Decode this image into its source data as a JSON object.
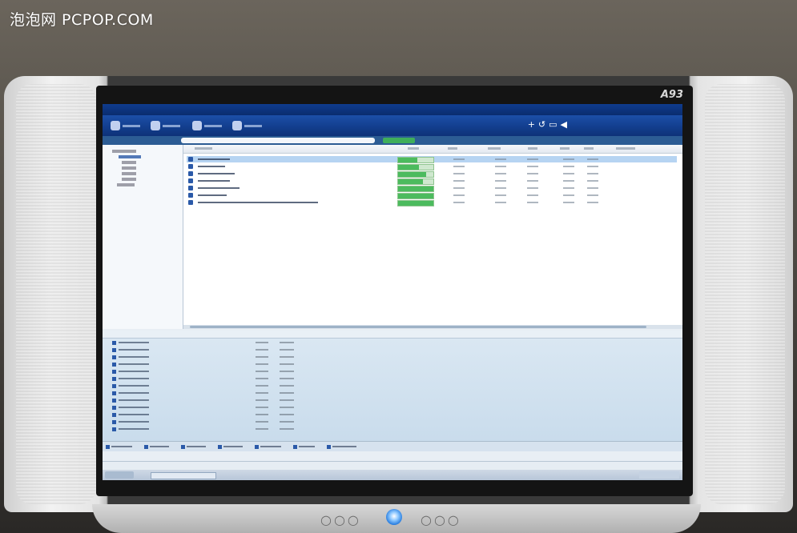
{
  "watermark": {
    "text": "泡泡网 PCPOP.COM"
  },
  "monitor": {
    "model_label": "A93"
  },
  "screen": {
    "toolbar_right_glyphs": "+↺▭◀",
    "list_rows": [
      {
        "progress": 0.55,
        "selected": true
      },
      {
        "progress": 0.6,
        "selected": false
      },
      {
        "progress": 0.8,
        "selected": false
      },
      {
        "progress": 0.7,
        "selected": false
      },
      {
        "progress": 1.0,
        "selected": false
      },
      {
        "progress": 1.0,
        "selected": false
      },
      {
        "progress": 1.0,
        "selected": false
      }
    ],
    "detail_row_count": 13,
    "tab_count": 7
  },
  "colors": {
    "toolbar": "#123d8c",
    "progress_fill": "#4cbb5e",
    "selection": "#b6d4f2",
    "power_led": "#2a7fe0"
  }
}
